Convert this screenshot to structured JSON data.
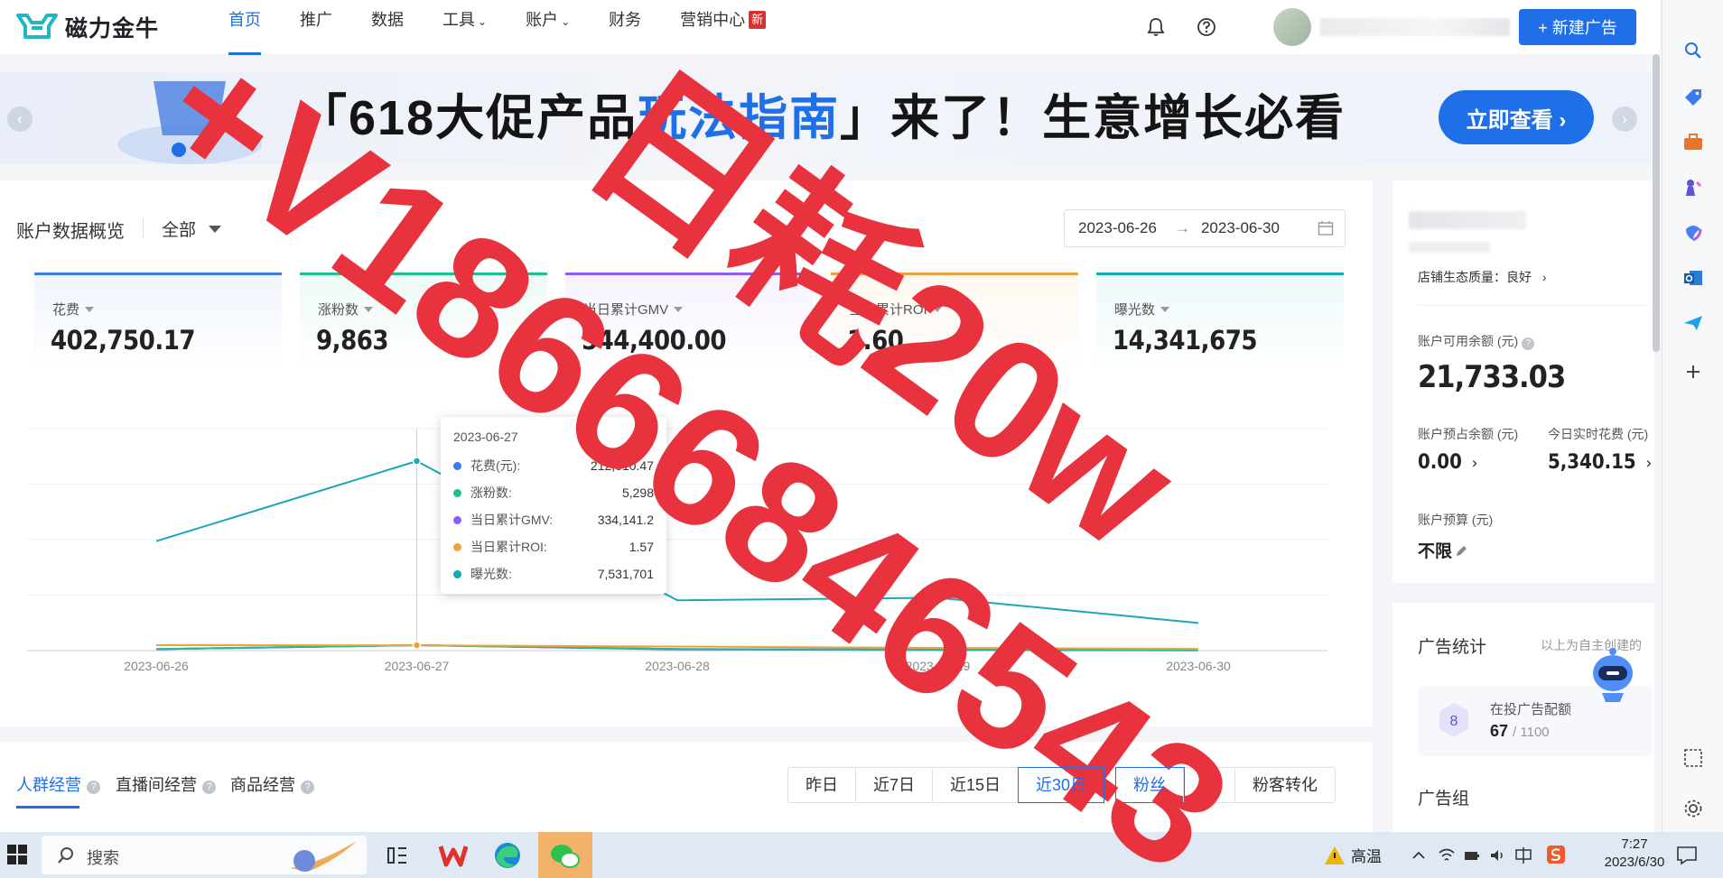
{
  "app": {
    "brand": "磁力金牛"
  },
  "nav": {
    "items": [
      {
        "label": "首页",
        "active": true,
        "caret": false,
        "badge": ""
      },
      {
        "label": "推广",
        "active": false,
        "caret": false,
        "badge": ""
      },
      {
        "label": "数据",
        "active": false,
        "caret": false,
        "badge": ""
      },
      {
        "label": "工具",
        "active": false,
        "caret": true,
        "badge": ""
      },
      {
        "label": "账户",
        "active": false,
        "caret": true,
        "badge": ""
      },
      {
        "label": "财务",
        "active": false,
        "caret": false,
        "badge": ""
      },
      {
        "label": "营销中心",
        "active": false,
        "caret": false,
        "badge": "新"
      }
    ],
    "new_ad_label": "+ 新建广告"
  },
  "banner": {
    "text_prefix": "「618大促产品",
    "text_highlight": "玩法指南",
    "text_suffix": "」来了！生意增长必看",
    "cta": "立即查看 ›"
  },
  "overview": {
    "title": "账户数据概览",
    "scope": "全部",
    "date_start": "2023-06-26",
    "date_arrow": "→",
    "date_end": "2023-06-30",
    "metrics": [
      {
        "label": "花费",
        "value": "402,750.17",
        "color": "#3d7be6"
      },
      {
        "label": "涨粉数",
        "value": "9,863",
        "color": "#1fbf8f"
      },
      {
        "label": "当日累计GMV",
        "value": "544,400.00",
        "color": "#8b5cf6"
      },
      {
        "label": "当日累计ROI",
        "value": "1.60",
        "color": "#f2a03d"
      },
      {
        "label": "曝光数",
        "value": "14,341,675",
        "color": "#1ba7b5"
      }
    ]
  },
  "chart_data": {
    "type": "line",
    "x": [
      "2023-06-26",
      "2023-06-27",
      "2023-06-28",
      "2023-06-29",
      "2023-06-30"
    ],
    "series": [
      {
        "name": "花费(元)",
        "color": "#3d7be6",
        "values": [
          55000,
          212610.47,
          60000,
          45000,
          30000
        ]
      },
      {
        "name": "涨粉数",
        "color": "#1fbf8f",
        "values": [
          1500,
          5298,
          1400,
          1000,
          665
        ]
      },
      {
        "name": "当日累计GMV",
        "color": "#8b5cf6",
        "values": [
          90000,
          334141.2,
          70000,
          35000,
          15000
        ]
      },
      {
        "name": "当日累计ROI",
        "color": "#f2a03d",
        "values": [
          1.6,
          1.57,
          1.2,
          0.8,
          0.5
        ]
      },
      {
        "name": "曝光数",
        "color": "#1ba7b5",
        "values": [
          4350000,
          7531701,
          2000000,
          2100000,
          1100000
        ]
      }
    ],
    "tooltip": {
      "date": "2023-06-27",
      "rows": [
        {
          "name": "花费(元):",
          "value": "212,610.47",
          "color": "#3d7be6"
        },
        {
          "name": "涨粉数:",
          "value": "5,298",
          "color": "#1fbf8f"
        },
        {
          "name": "当日累计GMV:",
          "value": "334,141.2",
          "color": "#8b5cf6"
        },
        {
          "name": "当日累计ROI:",
          "value": "1.57",
          "color": "#f2a03d"
        },
        {
          "name": "曝光数:",
          "value": "7,531,701",
          "color": "#1ba7b5"
        }
      ]
    }
  },
  "tabs": {
    "items": [
      "人群经营",
      "直播间经营",
      "商品经营"
    ],
    "periods": [
      "昨日",
      "近7日",
      "近15日",
      "近30日"
    ],
    "active_period": "近30日",
    "kinds": [
      "粉丝",
      "客",
      "粉客转化"
    ],
    "active_kind": "粉丝"
  },
  "account": {
    "shop_quality": "店铺生态质量：良好",
    "available_label": "账户可用余额 (元)",
    "available_value": "21,733.03",
    "reserved_label": "账户预占余额 (元)",
    "reserved_value": "0.00",
    "today_label": "今日实时花费 (元)",
    "today_value": "5,340.15",
    "budget_label": "账户预算 (元)",
    "budget_value": "不限"
  },
  "ad_stats": {
    "title": "广告统计",
    "note": "以上为自主创建的",
    "quota_label": "在投广告配额",
    "quota_badge": "8",
    "quota_used": "67",
    "quota_max": "/ 1100",
    "group_label": "广告组"
  },
  "taskbar": {
    "search_label": "搜索",
    "weather": "高温",
    "time": "7:27",
    "date": "2023/6/30"
  },
  "watermark": {
    "line1": "日耗20w",
    "line2": "+V18666846543",
    "color": "#e8323e"
  }
}
